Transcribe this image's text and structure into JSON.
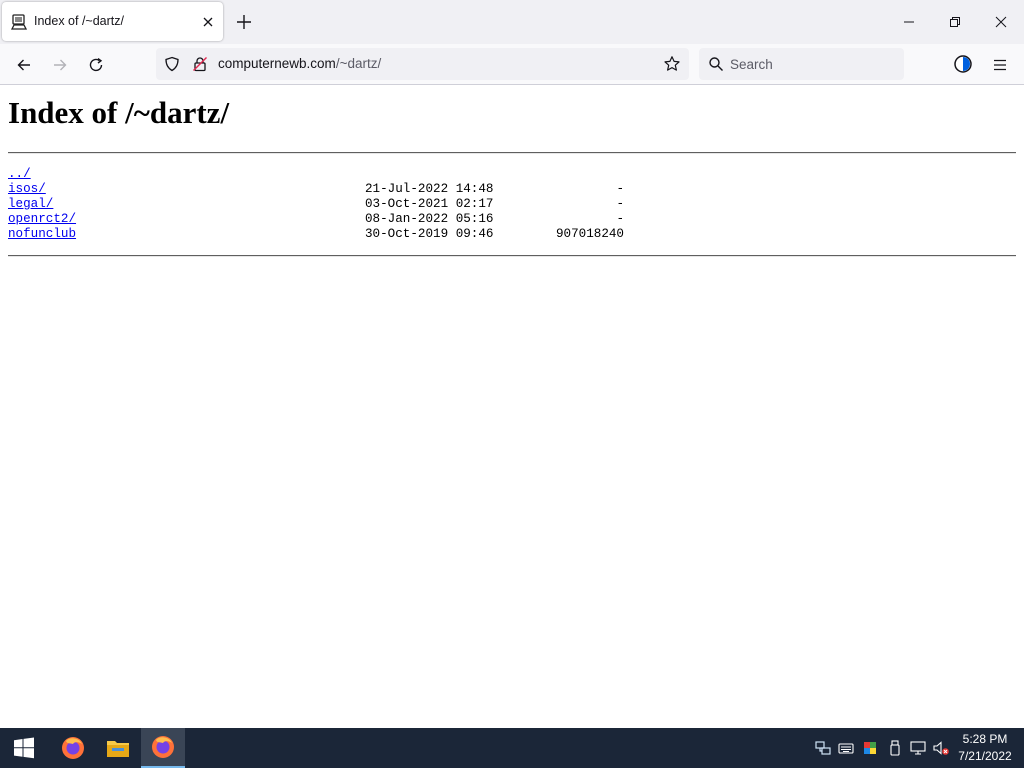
{
  "browser": {
    "tab": {
      "title": "Index of /~dartz/",
      "favicon": "directory-listing-icon"
    },
    "window_controls": [
      "minimize",
      "restore",
      "close"
    ],
    "nav": {
      "back": "back-arrow-icon",
      "forward": "forward-arrow-icon",
      "reload": "reload-icon"
    },
    "url": {
      "domain": "computernewb.com",
      "path": "/~dartz/"
    },
    "search": {
      "placeholder": "Search"
    }
  },
  "page": {
    "heading": "Index of /~dartz/",
    "entries": [
      {
        "name": "../",
        "date": "",
        "size": ""
      },
      {
        "name": "isos/",
        "date": "21-Jul-2022 14:48",
        "size": "-"
      },
      {
        "name": "legal/",
        "date": "03-Oct-2021 02:17",
        "size": "-"
      },
      {
        "name": "openrct2/",
        "date": "08-Jan-2022 05:16",
        "size": "-"
      },
      {
        "name": "nofunclub",
        "date": "30-Oct-2019 09:46",
        "size": "907018240"
      }
    ]
  },
  "taskbar": {
    "apps": [
      "windows-start-icon",
      "firefox-icon",
      "file-explorer-icon",
      "firefox-icon"
    ],
    "tray": [
      "network-icon",
      "keyboard-icon",
      "color-icon",
      "usb-icon",
      "monitor-network-icon",
      "volume-muted-icon"
    ],
    "clock": {
      "time": "5:28 PM",
      "date": "7/21/2022"
    }
  },
  "colors": {
    "link": "#0000ee",
    "taskbar": "#1b2638",
    "tabbar": "#f0f0f4"
  }
}
